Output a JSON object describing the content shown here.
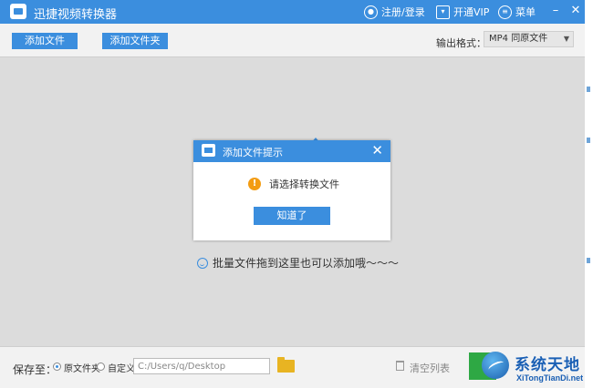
{
  "app": {
    "title": "迅捷视频转换器",
    "register_login": "注册/登录",
    "vip": "开通VIP",
    "menu": "菜单",
    "minimize": "–",
    "close": "✕"
  },
  "toolbar": {
    "add_file": "添加文件",
    "add_folder": "添加文件夹",
    "format_label": "输出格式：",
    "format_value": "MP4  同原文件",
    "format_caret": "▼"
  },
  "drop_area": {
    "hint": "批量文件拖到这里也可以添加哦～～～"
  },
  "dialog": {
    "title": "添加文件提示",
    "close": "✕",
    "warning_glyph": "!",
    "message": "请选择转换文件",
    "ok": "知道了"
  },
  "bottom": {
    "save_label": "保存至：",
    "option_original": "原文件夹",
    "option_custom": "自定义",
    "path_value": "C:/Users/q/Desktop",
    "clear_list": "清空列表"
  },
  "watermark": {
    "cn": "系统天地",
    "en": "XiTongTianDi.net"
  },
  "colors": {
    "accent": "#3b8ede",
    "warning": "#f39c12",
    "convert": "#2ea844",
    "folder": "#e8b422"
  }
}
